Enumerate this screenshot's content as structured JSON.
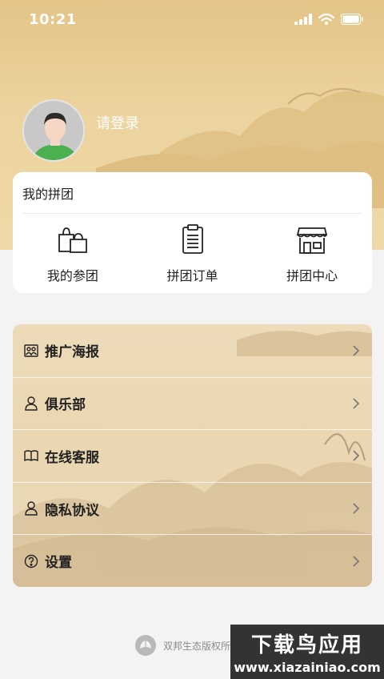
{
  "status_bar": {
    "time": "10:21"
  },
  "profile": {
    "login_text": "请登录"
  },
  "group_card": {
    "title": "我的拼团",
    "items": [
      {
        "label": "我的参团",
        "icon": "shopping-bags-icon"
      },
      {
        "label": "拼团订单",
        "icon": "clipboard-icon"
      },
      {
        "label": "拼团中心",
        "icon": "storefront-icon"
      }
    ]
  },
  "menu": {
    "items": [
      {
        "label": "推广海报",
        "icon": "people-poster-icon"
      },
      {
        "label": "俱乐部",
        "icon": "user-club-icon"
      },
      {
        "label": "在线客服",
        "icon": "book-service-icon"
      },
      {
        "label": "隐私协议",
        "icon": "user-privacy-icon"
      },
      {
        "label": "设置",
        "icon": "help-settings-icon"
      }
    ]
  },
  "footer": {
    "text": "双邦生态版权所"
  },
  "watermark": {
    "title": "下载鸟应用",
    "url": "www.xiazainiao.com"
  }
}
